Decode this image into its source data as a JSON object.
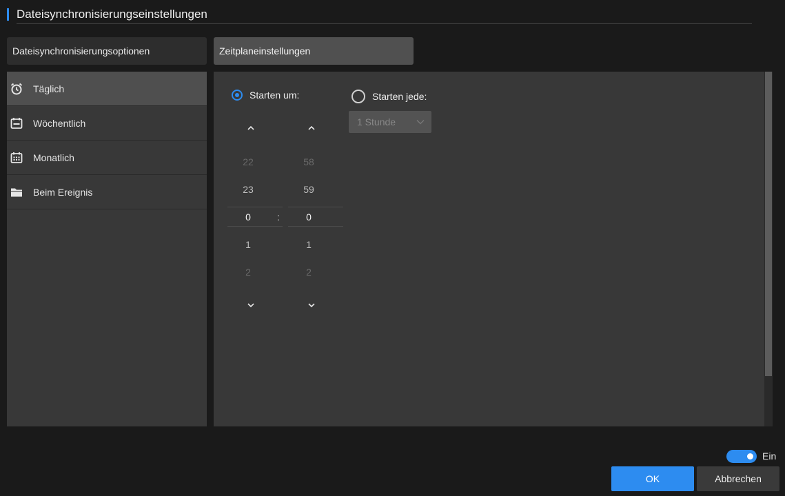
{
  "header": {
    "title": "Dateisynchronisierungseinstellungen"
  },
  "tabs": [
    {
      "label": "Dateisynchronisierungsoptionen"
    },
    {
      "label": "Zeitplaneinstellungen"
    }
  ],
  "sidebar": {
    "items": [
      {
        "label": "Täglich",
        "icon": "alarm-clock-icon"
      },
      {
        "label": "Wöchentlich",
        "icon": "calendar-week-icon"
      },
      {
        "label": "Monatlich",
        "icon": "calendar-month-icon"
      },
      {
        "label": "Beim Ereignis",
        "icon": "folder-icon"
      }
    ]
  },
  "schedule": {
    "start_at_label": "Starten um:",
    "start_every_label": "Starten jede:",
    "interval_value": "1 Stunde",
    "hours": [
      "22",
      "23",
      "0",
      "1",
      "2"
    ],
    "minutes": [
      "58",
      "59",
      "0",
      "1",
      "2"
    ],
    "separator": ":"
  },
  "footer": {
    "toggle_label": "Ein",
    "ok_label": "OK",
    "cancel_label": "Abbrechen"
  },
  "colors": {
    "accent": "#2d8cf0",
    "panel": "#383838",
    "background": "#1a1a1a"
  }
}
